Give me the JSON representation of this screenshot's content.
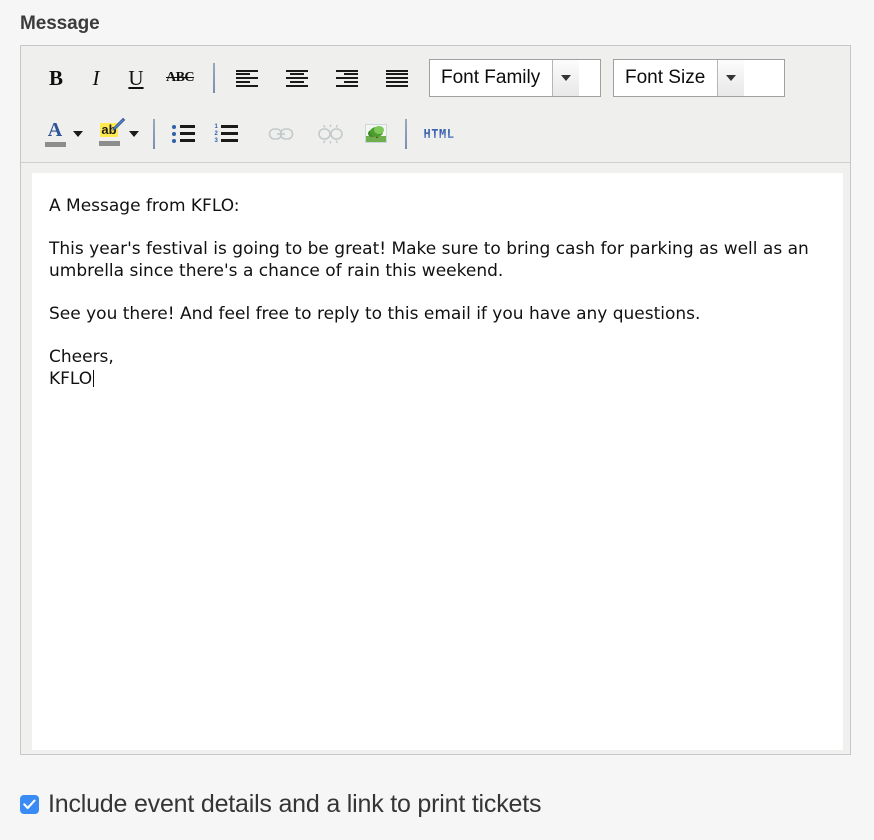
{
  "field": {
    "label": "Message"
  },
  "toolbar": {
    "row1": [
      {
        "name": "bold-icon",
        "label": "B"
      },
      {
        "name": "italic-icon",
        "label": "I"
      },
      {
        "name": "underline-icon",
        "label": "U"
      },
      {
        "name": "strikethrough-icon",
        "label": "ABC"
      },
      {
        "name": "align-left-icon",
        "label": "Align Left"
      },
      {
        "name": "align-center-icon",
        "label": "Align Center"
      },
      {
        "name": "align-right-icon",
        "label": "Align Right"
      },
      {
        "name": "align-justify-icon",
        "label": "Justify"
      }
    ],
    "row2": [
      {
        "name": "font-color-icon",
        "label": "A"
      },
      {
        "name": "highlight-color-icon",
        "label": "ab"
      },
      {
        "name": "bullet-list-icon",
        "label": "Unordered list"
      },
      {
        "name": "numbered-list-icon",
        "label": "Ordered list"
      },
      {
        "name": "insert-link-icon",
        "label": "Insert link"
      },
      {
        "name": "unlink-icon",
        "label": "Unlink"
      },
      {
        "name": "insert-image-icon",
        "label": "Insert image"
      },
      {
        "name": "html-source-button",
        "label": "HTML"
      }
    ],
    "font_family": {
      "value": "Font Family"
    },
    "font_size": {
      "value": "Font Size"
    }
  },
  "message_body": {
    "paragraphs": [
      "A Message from KFLO:",
      "This year's festival is going to be great! Make sure to bring cash for parking as well as an umbrella since there's a chance of rain this weekend.",
      "See you there! And feel free to reply to this email if you have any questions.",
      "Cheers,"
    ],
    "signature": "KFLO"
  },
  "include_details": {
    "checked": true,
    "label": "Include event details and a link to print tickets"
  },
  "colors": {
    "accent": "#3b8bf5",
    "toolbar_bg": "#efefed",
    "page_bg": "#f6f6f6",
    "border": "#c7c7c7",
    "text": "#353535",
    "highlight_yellow": "#ffe94d",
    "icon_blue": "#2d5496"
  }
}
